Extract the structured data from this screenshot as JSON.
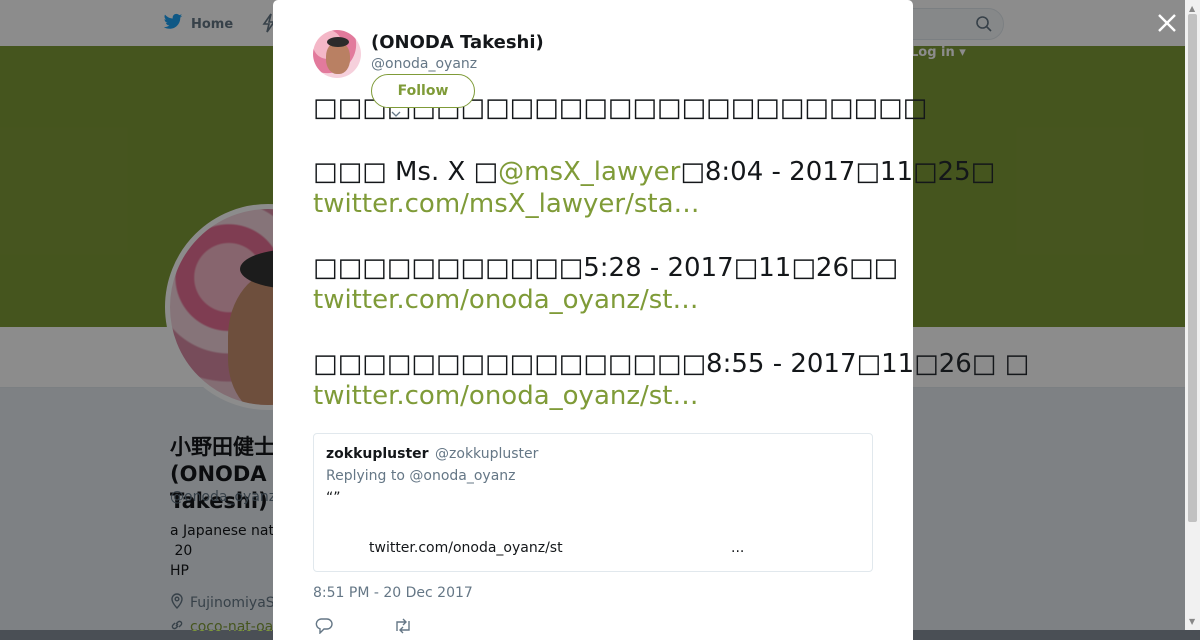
{
  "nav": {
    "home_label": "Home",
    "login_label": "Log in ▾"
  },
  "profile": {
    "name": "小野田健士(ONODA Takeshi)",
    "handle": "@onoda_oyanz",
    "bio": "a Japanese nat…\n 20\nHP",
    "location": "FujinomiyaS…",
    "url": "coco-nat-oa…"
  },
  "tweet": {
    "author_name": "(ONODA Takeshi)",
    "author_handle": "@onoda_oyanz",
    "follow_label": "Follow",
    "para1": "□□□□□□□□□□□□□□□□□□□□□□□□□",
    "para2_text": "□□□ Ms. X □",
    "para2_mention": "@msX_lawyer",
    "para2_after": "□8:04 - 2017□11□25□",
    "para2_link": "twitter.com/msX_lawyer/sta…",
    "para3_text": "□□□□□□□□□□□5:28 - 2017□11□26□□",
    "para3_link": "twitter.com/onoda_oyanz/st…",
    "para4_text": "□□□□□□□□□□□□□□□□8:55 - 2017□11□26□ □",
    "para4_link": "twitter.com/onoda_oyanz/st…",
    "timestamp": "8:51 PM - 20 Dec 2017"
  },
  "quoted_tweet": {
    "author_name": "zokkupluster",
    "author_handle": "@zokkupluster",
    "replying_to": "Replying to @onoda_oyanz",
    "body": "“”",
    "link": "twitter.com/onoda_oyanz/st",
    "ellipsis": "..."
  },
  "colors": {
    "accent": "#7f9b38",
    "banner": "#7f9b38",
    "overlay": "#000000",
    "text_secondary": "#657786"
  },
  "icons": [
    "twitter-bird-icon",
    "lightning-icon",
    "search-icon",
    "close-icon",
    "location-icon",
    "link-icon",
    "reply-icon",
    "retweet-icon"
  ]
}
